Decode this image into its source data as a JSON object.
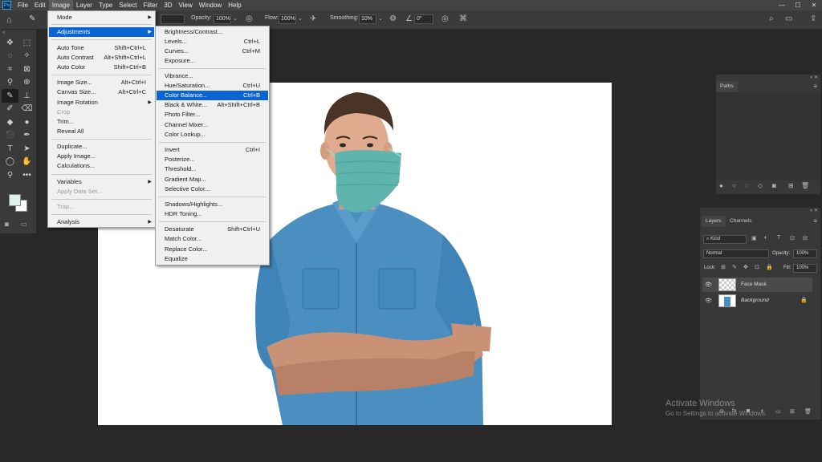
{
  "app": {
    "logo": "Ps"
  },
  "menubar": [
    "File",
    "Edit",
    "Image",
    "Layer",
    "Type",
    "Select",
    "Filter",
    "3D",
    "View",
    "Window",
    "Help"
  ],
  "options": {
    "opacity_label": "Opacity:",
    "opacity_value": "100%",
    "flow_label": "Flow:",
    "flow_value": "100%",
    "smoothing_label": "Smoothing:",
    "smoothing_value": "10%",
    "angle_value": "0°"
  },
  "image_menu": [
    {
      "label": "Mode",
      "arrow": true
    },
    {
      "label": "Adjustments",
      "arrow": true,
      "highlight": true
    },
    {
      "label": "Auto Tone",
      "shortcut": "Shift+Ctrl+L"
    },
    {
      "label": "Auto Contrast",
      "shortcut": "Alt+Shift+Ctrl+L"
    },
    {
      "label": "Auto Color",
      "shortcut": "Shift+Ctrl+B"
    },
    {
      "label": "Image Size...",
      "shortcut": "Alt+Ctrl+I"
    },
    {
      "label": "Canvas Size...",
      "shortcut": "Alt+Ctrl+C"
    },
    {
      "label": "Image Rotation",
      "arrow": true
    },
    {
      "label": "Crop",
      "disabled": true
    },
    {
      "label": "Trim..."
    },
    {
      "label": "Reveal All"
    },
    {
      "label": "Duplicate..."
    },
    {
      "label": "Apply Image..."
    },
    {
      "label": "Calculations..."
    },
    {
      "label": "Variables",
      "arrow": true
    },
    {
      "label": "Apply Data Set...",
      "disabled": true
    },
    {
      "label": "Trap...",
      "disabled": true
    },
    {
      "label": "Analysis",
      "arrow": true
    }
  ],
  "adjustments_menu": [
    {
      "label": "Brightness/Contrast..."
    },
    {
      "label": "Levels...",
      "shortcut": "Ctrl+L"
    },
    {
      "label": "Curves...",
      "shortcut": "Ctrl+M"
    },
    {
      "label": "Exposure..."
    },
    {
      "label": "Vibrance..."
    },
    {
      "label": "Hue/Saturation...",
      "shortcut": "Ctrl+U"
    },
    {
      "label": "Color Balance...",
      "shortcut": "Ctrl+B",
      "highlight": true
    },
    {
      "label": "Black & White...",
      "shortcut": "Alt+Shift+Ctrl+B"
    },
    {
      "label": "Photo Filter..."
    },
    {
      "label": "Channel Mixer..."
    },
    {
      "label": "Color Lookup..."
    },
    {
      "label": "Invert",
      "shortcut": "Ctrl+I"
    },
    {
      "label": "Posterize..."
    },
    {
      "label": "Threshold..."
    },
    {
      "label": "Gradient Map..."
    },
    {
      "label": "Selective Color..."
    },
    {
      "label": "Shadows/Highlights..."
    },
    {
      "label": "HDR Toning..."
    },
    {
      "label": "Desaturate",
      "shortcut": "Shift+Ctrl+U"
    },
    {
      "label": "Match Color..."
    },
    {
      "label": "Replace Color..."
    },
    {
      "label": "Equalize"
    }
  ],
  "paths_panel": {
    "tab": "Paths"
  },
  "layers_panel": {
    "tabs": [
      "Layers",
      "Channels"
    ],
    "kind_label": "Kind",
    "blend_mode": "Normal",
    "opacity_label": "Opacity:",
    "opacity_value": "100%",
    "lock_label": "Lock:",
    "fill_label": "Fill:",
    "fill_value": "100%",
    "layers": [
      {
        "name": "Face Mask",
        "selected": true
      },
      {
        "name": "Background",
        "locked": true
      }
    ]
  },
  "watermark": {
    "line1": "Activate Windows",
    "line2": "Go to Settings to activate Windows."
  },
  "colors": {
    "highlight": "#0a64d2",
    "foreground_swatch": "#dff2ef",
    "mask": "#5fb5ad",
    "shirt": "#4a8fc0"
  }
}
